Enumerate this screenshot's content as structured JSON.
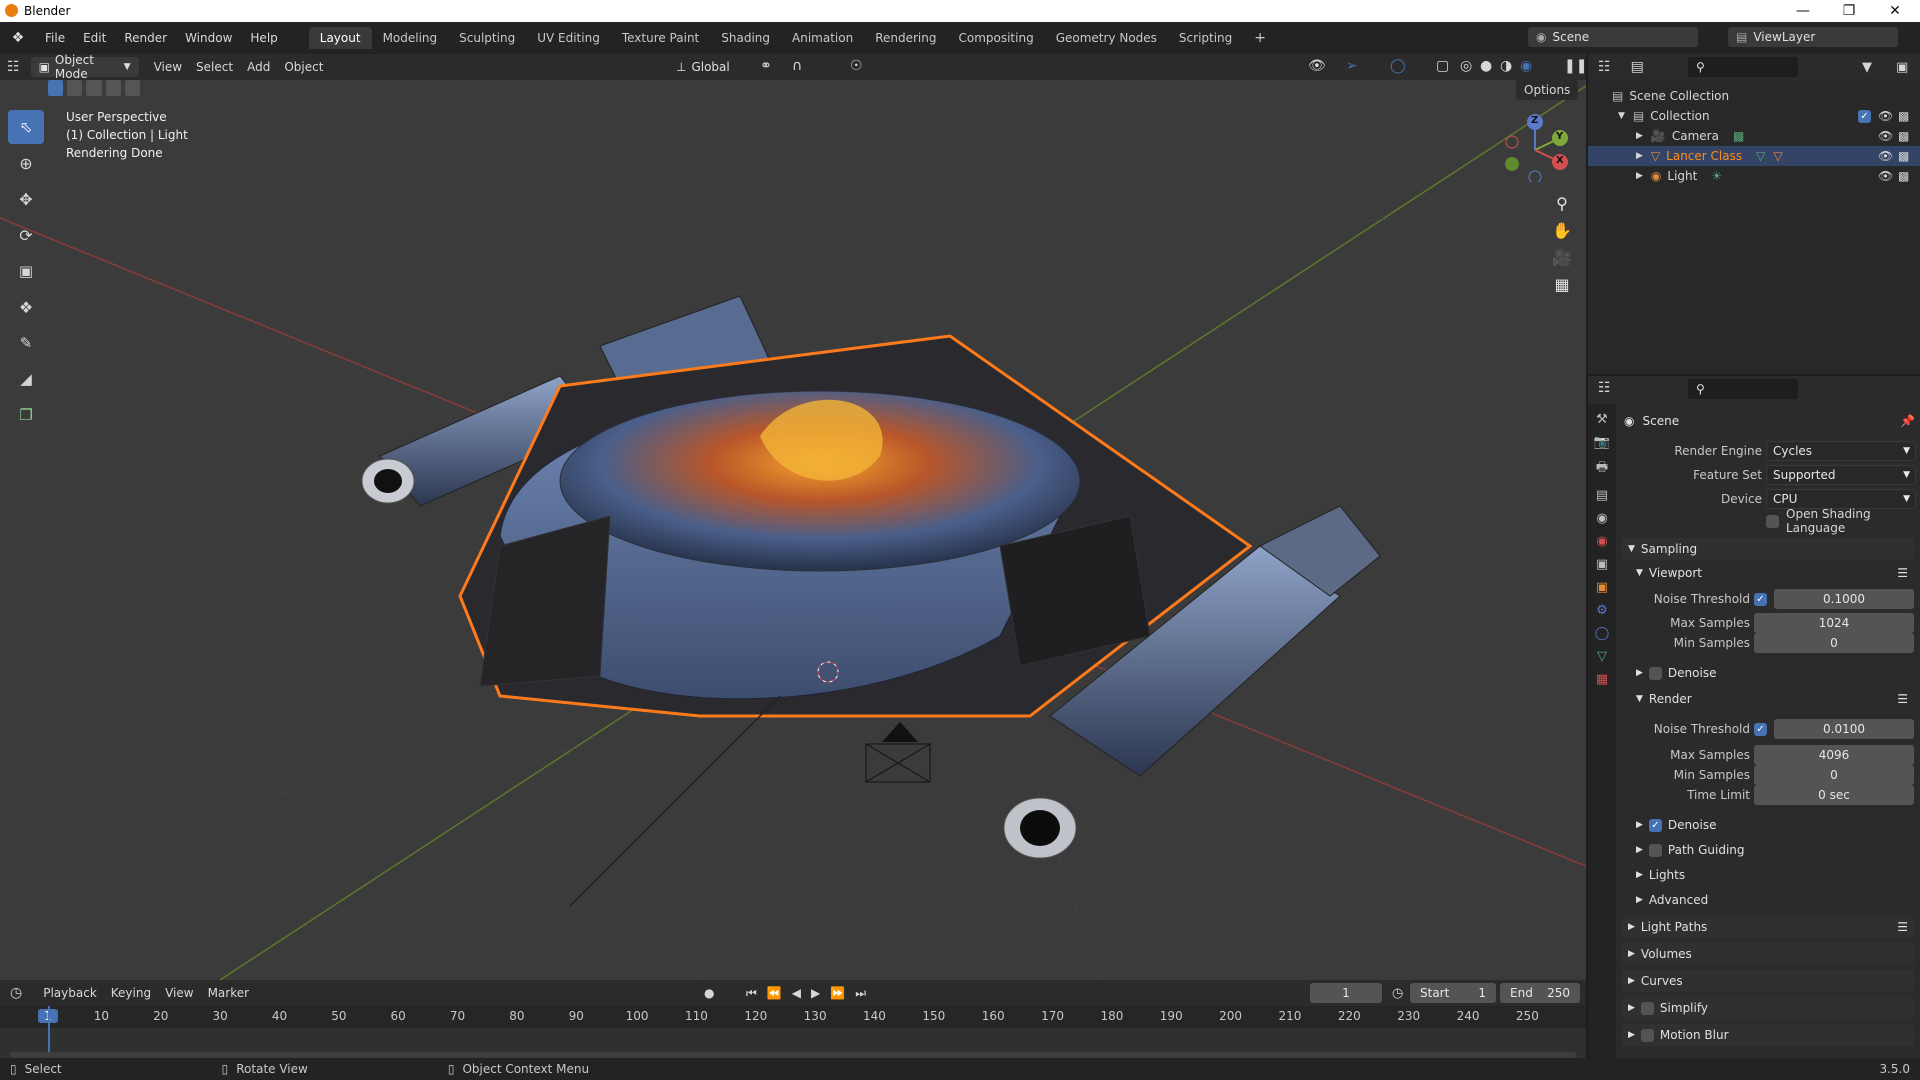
{
  "app": {
    "title": "Blender",
    "version": "3.5.0"
  },
  "menus": [
    "File",
    "Edit",
    "Render",
    "Window",
    "Help"
  ],
  "workspaces": [
    {
      "label": "Layout",
      "active": true
    },
    {
      "label": "Modeling"
    },
    {
      "label": "Sculpting"
    },
    {
      "label": "UV Editing"
    },
    {
      "label": "Texture Paint"
    },
    {
      "label": "Shading"
    },
    {
      "label": "Animation"
    },
    {
      "label": "Rendering"
    },
    {
      "label": "Compositing"
    },
    {
      "label": "Geometry Nodes"
    },
    {
      "label": "Scripting"
    }
  ],
  "scene_field": "Scene",
  "viewlayer_field": "ViewLayer",
  "viewport_header": {
    "mode": "Object Mode",
    "menus": [
      "View",
      "Select",
      "Add",
      "Object"
    ],
    "orientation": "Global",
    "options_label": "Options"
  },
  "viewport_overlay": {
    "line1": "User Perspective",
    "line2": "(1) Collection | Light",
    "line3": "Rendering Done"
  },
  "gizmo": {
    "x": "X",
    "y": "Y",
    "z": "Z"
  },
  "outliner": {
    "root": "Scene Collection",
    "collection": "Collection",
    "items": [
      {
        "name": "Camera",
        "selected": false
      },
      {
        "name": "Lancer Class",
        "selected": true
      },
      {
        "name": "Light",
        "selected": false
      }
    ]
  },
  "properties": {
    "context": "Scene",
    "render_engine_label": "Render Engine",
    "render_engine": "Cycles",
    "feature_set_label": "Feature Set",
    "feature_set": "Supported",
    "device_label": "Device",
    "device": "CPU",
    "osl_label": "Open Shading Language",
    "sampling": "Sampling",
    "viewport": "Viewport",
    "noise_threshold_label": "Noise Threshold",
    "vp_noise_threshold": "0.1000",
    "max_samples_label": "Max Samples",
    "vp_max_samples": "1024",
    "min_samples_label": "Min Samples",
    "vp_min_samples": "0",
    "denoise_label": "Denoise",
    "render": "Render",
    "r_noise_threshold": "0.0100",
    "r_max_samples": "4096",
    "r_min_samples": "0",
    "time_limit_label": "Time Limit",
    "r_time_limit": "0 sec",
    "path_guiding": "Path Guiding",
    "lights": "Lights",
    "advanced": "Advanced",
    "light_paths": "Light Paths",
    "volumes": "Volumes",
    "curves": "Curves",
    "simplify": "Simplify",
    "motion_blur": "Motion Blur"
  },
  "timeline": {
    "menus": [
      "Playback",
      "Keying",
      "View",
      "Marker"
    ],
    "current_frame": "1",
    "start_label": "Start",
    "start": "1",
    "end_label": "End",
    "end": "250",
    "ticks": [
      "1",
      "10",
      "20",
      "30",
      "40",
      "50",
      "60",
      "70",
      "80",
      "90",
      "100",
      "110",
      "120",
      "130",
      "140",
      "150",
      "160",
      "170",
      "180",
      "190",
      "200",
      "210",
      "220",
      "230",
      "240",
      "250"
    ]
  },
  "statusbar": {
    "select": "Select",
    "rotate": "Rotate View",
    "context_menu": "Object Context Menu"
  },
  "colors": {
    "accent": "#4772b3",
    "selected_object": "#ff8c1a",
    "axis_red": "#d05050",
    "axis_green": "#7fa83a"
  }
}
